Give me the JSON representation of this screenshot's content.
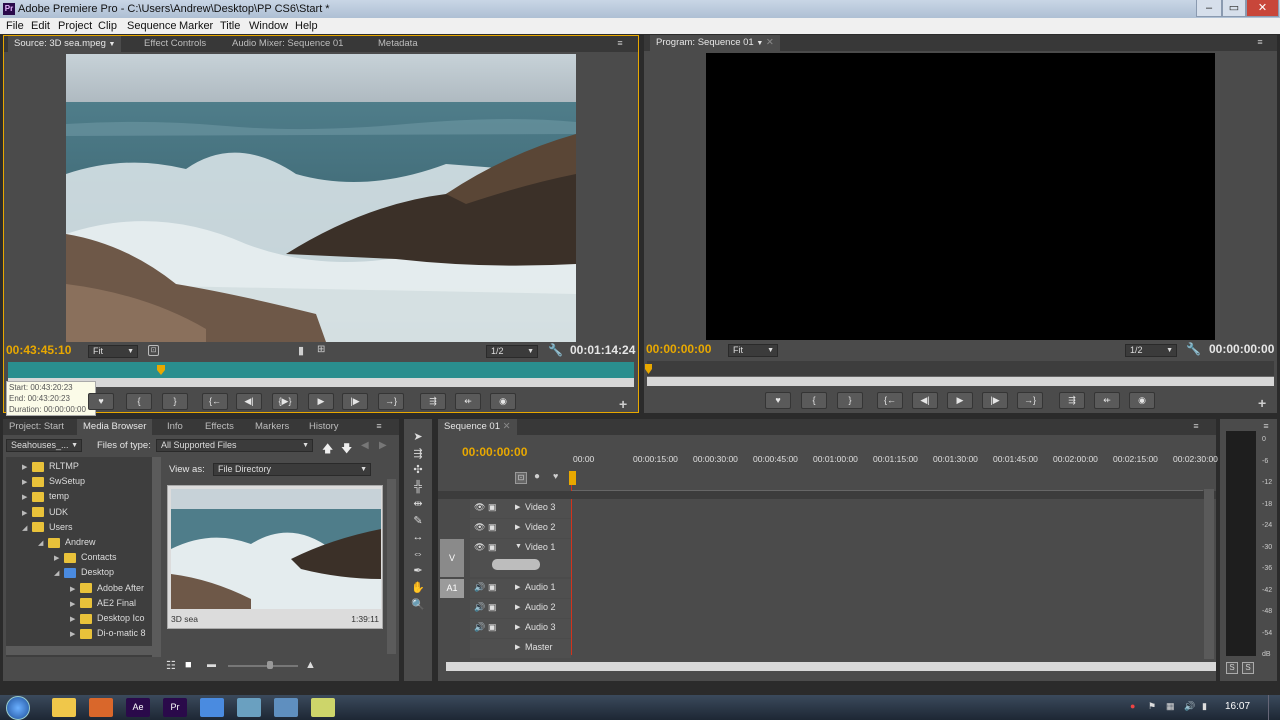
{
  "window": {
    "title": "Adobe Premiere Pro - C:\\Users\\Andrew\\Desktop\\PP CS6\\Start *",
    "app_icon": "Pr",
    "minimize": "–",
    "maximize": "▭",
    "close": "✕"
  },
  "menu": [
    "File",
    "Edit",
    "Project",
    "Clip",
    "Sequence",
    "Marker",
    "Title",
    "Window",
    "Help"
  ],
  "source_panel": {
    "tabs": [
      "Source: 3D sea.mpeg",
      "Effect Controls",
      "Audio Mixer: Sequence 01",
      "Metadata"
    ],
    "timecode_in": "00:43:45:10",
    "zoom": "Fit",
    "resolution": "1/2",
    "duration": "00:01:14:24",
    "tooltip": {
      "start": "Start: 00:43:20:23",
      "end": "End: 00:43:20:23",
      "duration": "Duration: 00:00:00:00"
    },
    "controls": [
      "♥",
      "{",
      "}",
      "{←",
      "◀|",
      "{▶}",
      "▶",
      "|▶",
      "→}",
      "⇶",
      "⇷",
      "◉"
    ],
    "add": "+"
  },
  "program_panel": {
    "tabs": [
      "Program: Sequence 01"
    ],
    "timecode": "00:00:00:00",
    "zoom": "Fit",
    "resolution": "1/2",
    "duration": "00:00:00:00",
    "controls": [
      "♥",
      "{",
      "}",
      "{←",
      "◀|",
      "▶",
      "|▶",
      "→}",
      "⇶",
      "⇷",
      "◉"
    ],
    "add": "+"
  },
  "project_panel": {
    "tabs": [
      "Project: Start",
      "Media Browser",
      "Info",
      "Effects",
      "Markers",
      "History"
    ],
    "drive": "Seahouses_...",
    "files_of_type_label": "Files of type:",
    "files_of_type": "All Supported Files",
    "view_as_label": "View as:",
    "view_as": "File Directory",
    "tree": [
      {
        "label": "RLTMP",
        "depth": 0,
        "blue": false
      },
      {
        "label": "SwSetup",
        "depth": 0,
        "blue": false
      },
      {
        "label": "temp",
        "depth": 0,
        "blue": false
      },
      {
        "label": "UDK",
        "depth": 0,
        "blue": false
      },
      {
        "label": "Users",
        "depth": 0,
        "blue": false,
        "open": true
      },
      {
        "label": "Andrew",
        "depth": 1,
        "blue": false,
        "open": true
      },
      {
        "label": "Contacts",
        "depth": 2,
        "blue": false
      },
      {
        "label": "Desktop",
        "depth": 2,
        "blue": true,
        "open": true
      },
      {
        "label": "Adobe After",
        "depth": 3,
        "blue": false
      },
      {
        "label": "AE2 Final",
        "depth": 3,
        "blue": false
      },
      {
        "label": "Desktop Ico",
        "depth": 3,
        "blue": false
      },
      {
        "label": "Di-o-matic 8",
        "depth": 3,
        "blue": false
      }
    ],
    "clip_name": "3D sea",
    "clip_duration": "1:39:11"
  },
  "sequence_panel": {
    "tab": "Sequence 01",
    "timecode": "00:00:00:00",
    "ruler": [
      "00:00",
      "00:00:15:00",
      "00:00:30:00",
      "00:00:45:00",
      "00:01:00:00",
      "00:01:15:00",
      "00:01:30:00",
      "00:01:45:00",
      "00:02:00:00",
      "00:02:15:00",
      "00:02:30:00"
    ],
    "tracks": [
      {
        "name": "Video 3",
        "kind": "video",
        "target": ""
      },
      {
        "name": "Video 2",
        "kind": "video",
        "target": ""
      },
      {
        "name": "Video 1",
        "kind": "video",
        "target": "V",
        "open": true
      },
      {
        "name": "Audio 1",
        "kind": "audio",
        "target": "A1"
      },
      {
        "name": "Audio 2",
        "kind": "audio",
        "target": ""
      },
      {
        "name": "Audio 3",
        "kind": "audio",
        "target": ""
      },
      {
        "name": "Master",
        "kind": "master",
        "target": ""
      }
    ]
  },
  "meters": {
    "labels": [
      "0",
      "-6",
      "-12",
      "-18",
      "-24",
      "-30",
      "-36",
      "-42",
      "-48",
      "-54",
      "dB"
    ],
    "solo_left": "S",
    "solo_right": "S"
  },
  "taskbar": {
    "clock": "16:07",
    "apps": [
      "",
      "",
      "",
      "Ae",
      "Pr",
      "",
      "",
      "",
      ""
    ]
  },
  "colors": {
    "accent": "#e8a800",
    "panel": "#4b4b4b",
    "panel_dark": "#383838",
    "playhead": "#e8a800",
    "audio_target": "#9b9b9b"
  }
}
